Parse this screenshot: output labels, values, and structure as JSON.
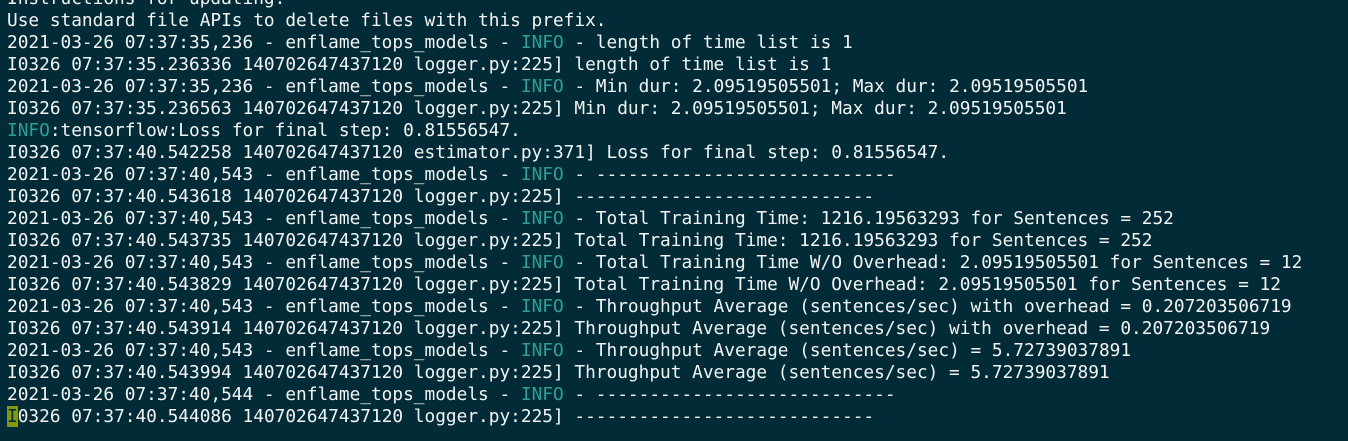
{
  "terminal": {
    "colors": {
      "background": "#012b36",
      "foreground": "#f4f4f4",
      "log_level": "#2aa198",
      "cursor": "#859900"
    },
    "lines": [
      {
        "segments": [
          {
            "text": "Instructions for updating:"
          }
        ]
      },
      {
        "segments": [
          {
            "text": "Use standard file APIs to delete files with this prefix."
          }
        ]
      },
      {
        "segments": [
          {
            "text": "2021-03-26 07:37:35,236 - enflame_tops_models - "
          },
          {
            "text": "INFO",
            "level": true
          },
          {
            "text": " - length of time list is 1"
          }
        ]
      },
      {
        "segments": [
          {
            "text": "I0326 07:37:35.236336 140702647437120 logger.py:225] length of time list is 1"
          }
        ]
      },
      {
        "segments": [
          {
            "text": "2021-03-26 07:37:35,236 - enflame_tops_models - "
          },
          {
            "text": "INFO",
            "level": true
          },
          {
            "text": " - Min dur: 2.09519505501; Max dur: 2.09519505501"
          }
        ]
      },
      {
        "segments": [
          {
            "text": "I0326 07:37:35.236563 140702647437120 logger.py:225] Min dur: 2.09519505501; Max dur: 2.09519505501"
          }
        ]
      },
      {
        "segments": [
          {
            "text": "INFO",
            "level": true
          },
          {
            "text": ":tensorflow:Loss for final step: 0.81556547."
          }
        ]
      },
      {
        "segments": [
          {
            "text": "I0326 07:37:40.542258 140702647437120 estimator.py:371] Loss for final step: 0.81556547."
          }
        ]
      },
      {
        "segments": [
          {
            "text": "2021-03-26 07:37:40,543 - enflame_tops_models - "
          },
          {
            "text": "INFO",
            "level": true
          },
          {
            "text": " - ----------------------------"
          }
        ]
      },
      {
        "segments": [
          {
            "text": "I0326 07:37:40.543618 140702647437120 logger.py:225] ----------------------------"
          }
        ]
      },
      {
        "segments": [
          {
            "text": "2021-03-26 07:37:40,543 - enflame_tops_models - "
          },
          {
            "text": "INFO",
            "level": true
          },
          {
            "text": " - Total Training Time: 1216.19563293 for Sentences = 252"
          }
        ]
      },
      {
        "segments": [
          {
            "text": "I0326 07:37:40.543735 140702647437120 logger.py:225] Total Training Time: 1216.19563293 for Sentences = 252"
          }
        ]
      },
      {
        "segments": [
          {
            "text": "2021-03-26 07:37:40,543 - enflame_tops_models - "
          },
          {
            "text": "INFO",
            "level": true
          },
          {
            "text": " - Total Training Time W/O Overhead: 2.09519505501 for Sentences = 12"
          }
        ]
      },
      {
        "segments": [
          {
            "text": "I0326 07:37:40.543829 140702647437120 logger.py:225] Total Training Time W/O Overhead: 2.09519505501 for Sentences = 12"
          }
        ]
      },
      {
        "segments": [
          {
            "text": "2021-03-26 07:37:40,543 - enflame_tops_models - "
          },
          {
            "text": "INFO",
            "level": true
          },
          {
            "text": " - Throughput Average (sentences/sec) with overhead = 0.207203506719"
          }
        ]
      },
      {
        "segments": [
          {
            "text": "I0326 07:37:40.543914 140702647437120 logger.py:225] Throughput Average (sentences/sec) with overhead = 0.207203506719"
          }
        ]
      },
      {
        "segments": [
          {
            "text": "2021-03-26 07:37:40,543 - enflame_tops_models - "
          },
          {
            "text": "INFO",
            "level": true
          },
          {
            "text": " - Throughput Average (sentences/sec) = 5.72739037891"
          }
        ]
      },
      {
        "segments": [
          {
            "text": "I0326 07:37:40.543994 140702647437120 logger.py:225] Throughput Average (sentences/sec) = 5.72739037891"
          }
        ]
      },
      {
        "segments": [
          {
            "text": "2021-03-26 07:37:40,544 - enflame_tops_models - "
          },
          {
            "text": "INFO",
            "level": true
          },
          {
            "text": " - ----------------------------"
          }
        ]
      },
      {
        "segments": [
          {
            "text": "I",
            "cursor": true
          },
          {
            "text": "0326 07:37:40.544086 140702647437120 logger.py:225] ----------------------------"
          }
        ]
      }
    ]
  }
}
